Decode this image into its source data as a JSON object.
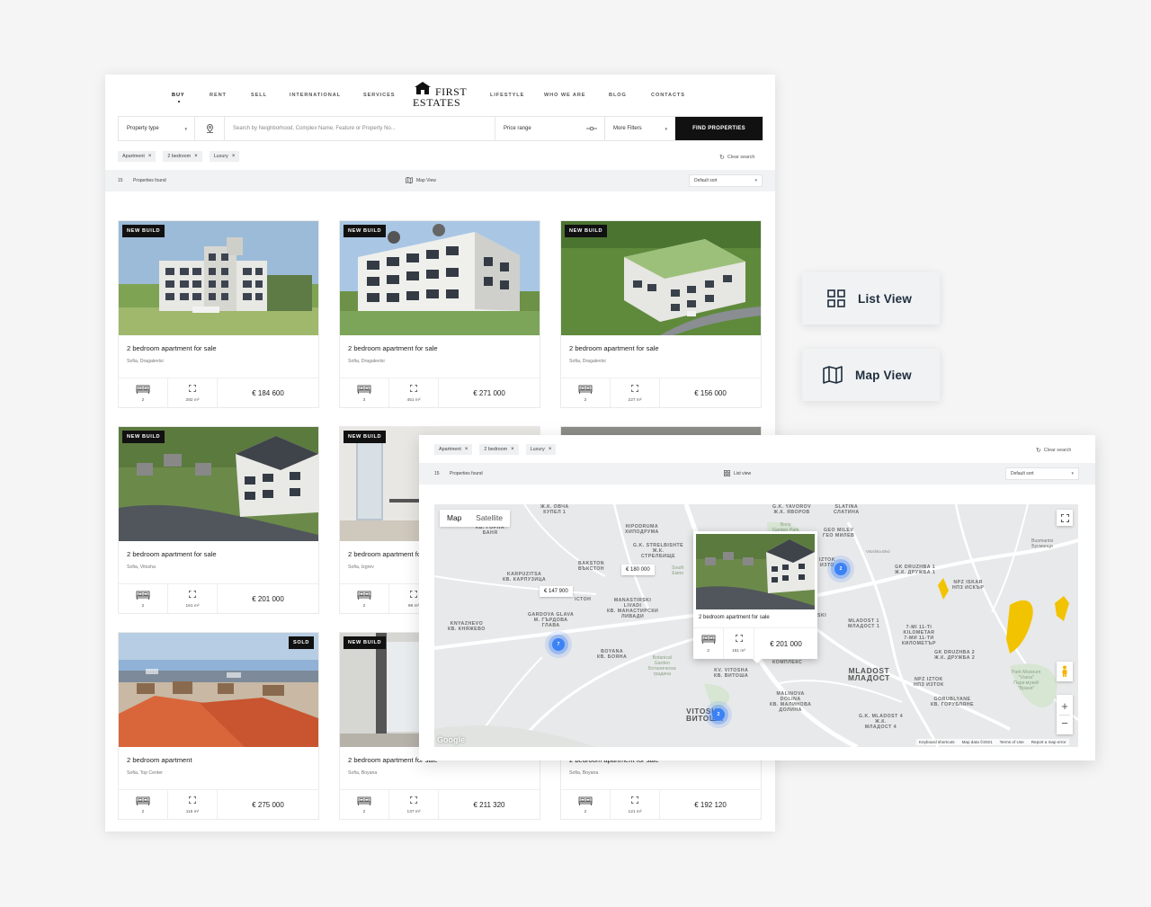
{
  "nav": {
    "items": [
      "BUY",
      "RENT",
      "SELL",
      "INTERNATIONAL",
      "SERVICES",
      "LIFESTYLE",
      "WHO WE ARE",
      "BLOG",
      "CONTACTS"
    ],
    "logo_line1": "FIRST",
    "logo_line2": "ESTATES"
  },
  "search": {
    "property_type": "Property type",
    "placeholder": "Search by Neighborhood, Complex Name, Feature or Property No...",
    "price_range": "Price range",
    "more_filters": "More Filters",
    "find_label": "FIND PROPERTIES"
  },
  "filters": {
    "chips": [
      "Apartment",
      "2 bedroom",
      "Luxury"
    ],
    "clear_label": "Clear search"
  },
  "results": {
    "count": "15",
    "found_label": "Properties found",
    "map_view_label": "Map View",
    "list_view_label": "List view",
    "sort_label": "Default sort"
  },
  "listings": [
    {
      "badge": "NEW BUILD",
      "title": "2 bedroom apartment for sale",
      "location": "Sofia, Dragalevtsi",
      "beds": "2",
      "area": "282 m²",
      "price": "€ 184 600"
    },
    {
      "badge": "NEW BUILD",
      "title": "2 bedroom apartment for sale",
      "location": "Sofia, Dragalevtsi",
      "beds": "3",
      "area": "451 m²",
      "price": "€ 271 000"
    },
    {
      "badge": "NEW BUILD",
      "title": "2 bedroom apartment for sale",
      "location": "Sofia, Dragalevtsi",
      "beds": "2",
      "area": "227 m²",
      "price": "€ 156 000"
    },
    {
      "badge": "NEW BUILD",
      "title": "2 bedroom apartment for sale",
      "location": "Sofia, Vitosha",
      "beds": "2",
      "area": "161 m²",
      "price": "€ 201 000"
    },
    {
      "badge": "NEW BUILD",
      "title": "2 bedroom apartment for sale",
      "location": "Sofia, Izgrev",
      "beds": "2",
      "area": "98 m²",
      "price": ""
    },
    {
      "badge": "",
      "title": "",
      "location": "",
      "beds": "",
      "area": "",
      "price": ""
    },
    {
      "badge": "SOLD",
      "title": "2 bedroom apartment",
      "location": "Sofia, Top Center",
      "beds": "2",
      "area": "115 m²",
      "price": "€ 275 000"
    },
    {
      "badge": "NEW BUILD",
      "title": "2 bedroom apartment for sale",
      "location": "Sofia, Boyana",
      "beds": "2",
      "area": "137 m²",
      "price": "€ 211 320"
    },
    {
      "badge": "",
      "title": "2 bedroom apartment for sale",
      "location": "Sofia, Boyana",
      "beds": "2",
      "area": "121 m²",
      "price": "€ 192 120"
    }
  ],
  "view_buttons": {
    "list_view": "List View",
    "map_view": "Map View"
  },
  "map": {
    "type_map": "Map",
    "type_satellite": "Satellite",
    "price_tags": [
      "€ 180 000",
      "€ 147 900"
    ],
    "clusters": [
      "2",
      "7",
      "2"
    ],
    "popup": {
      "title": "2 bedroom apartment for sale",
      "beds": "3",
      "area": "161 m²",
      "price": "€ 201 000"
    },
    "footer": [
      "Keyboard shortcuts",
      "Map data ©2021",
      "Terms of Use",
      "Report a map error"
    ],
    "google": "Google",
    "labels": {
      "g_yavorov": "G.K. YAVOROV\nЖ.К. ЯВОРОВ",
      "slatina": "SLATINA\nСЛАТИНА",
      "hipodruma": "HIPODRUMA\nХИПОДРУМА",
      "strelbishte": "G.K. STRELBISHTE\nЖ.К.\nСТРЕЛБИЩЕ",
      "geo_milev": "GEO MILEV\nГЕО МИЛЕВ",
      "baksion": "BAKSTON\nВЪКСТОН",
      "karpuzitsa": "KARPUZITSA\nКВ. КАРПУЗИЦА",
      "manastirski": "MANASTIRSKI\nLIVADI\nКВ. МАНАСТИРСКИ\nЛИВАДИ",
      "gardova": "GARDOVA GLAVA\nМ. ГЪРДОВА\nГЛАВА",
      "knyazhevo": "KNYAZHEVO\nКВ. КНЯЖЕВО",
      "boyana": "BOYANA\nКВ. БОЯНА",
      "vitosha": "KV. VITOSHA\nКВ. ВИТОША",
      "malinova": "MALINOVA\nDOLINA\nКВ. МАЛИНОВА\nДОЛИНА",
      "druzhba1": "GK DRUZHBA 1\nЖ.К. ДРУЖБА 1",
      "npz_iskar": "NPZ ISKAR\nНПЗ ИСКЪР",
      "mladost1": "MLADOST 1\nМЛАДОСТ 1",
      "kilometar": "7-MI 11-TI\nKILOMETAR\n7-МИ 11-ТИ\nКИЛОМЕТЪР",
      "druzhba2": "GK DRUZHBA 2\nЖ.К. ДРУЖБА 2",
      "mladost_big": "MLADOST\nМЛАДОСТ",
      "npz_iztok": "NPZ IZTOK\nНПЗ ИЗТОК",
      "gorublyane": "GORUBLYANE\nКВ. ГОРУБЛЯНЕ",
      "mladost4": "G.K. MLADOST 4\nЖ.К.\nМЛАДОСТ 4",
      "vitosha_big": "VITOSHA\nВИТОША",
      "gorna_banya": "КВ. ГОРНА\nБАНЯ",
      "ovcha_kupel": "Ж.К. ОВЧА\nКУПЕЛ 1",
      "busmantsi": "Busmantsi\nБусманци",
      "iztok": "IZTOK\nИЗТО",
      "botanical": "Botanical\nGarden\nБотаническа\nградина",
      "park_museum": "Park-Museum\n\"Vrana\"\nПарк-музей\n\"Враня\"",
      "south": "South\nЕмпо",
      "borisova": "Boris\nGarden Park",
      "kompleks": "КОМПЛЕКС",
      "ski": "SKI",
      "stoh": "ІСТОН",
      "vitoshka": "Vitoshka Blvd"
    }
  }
}
